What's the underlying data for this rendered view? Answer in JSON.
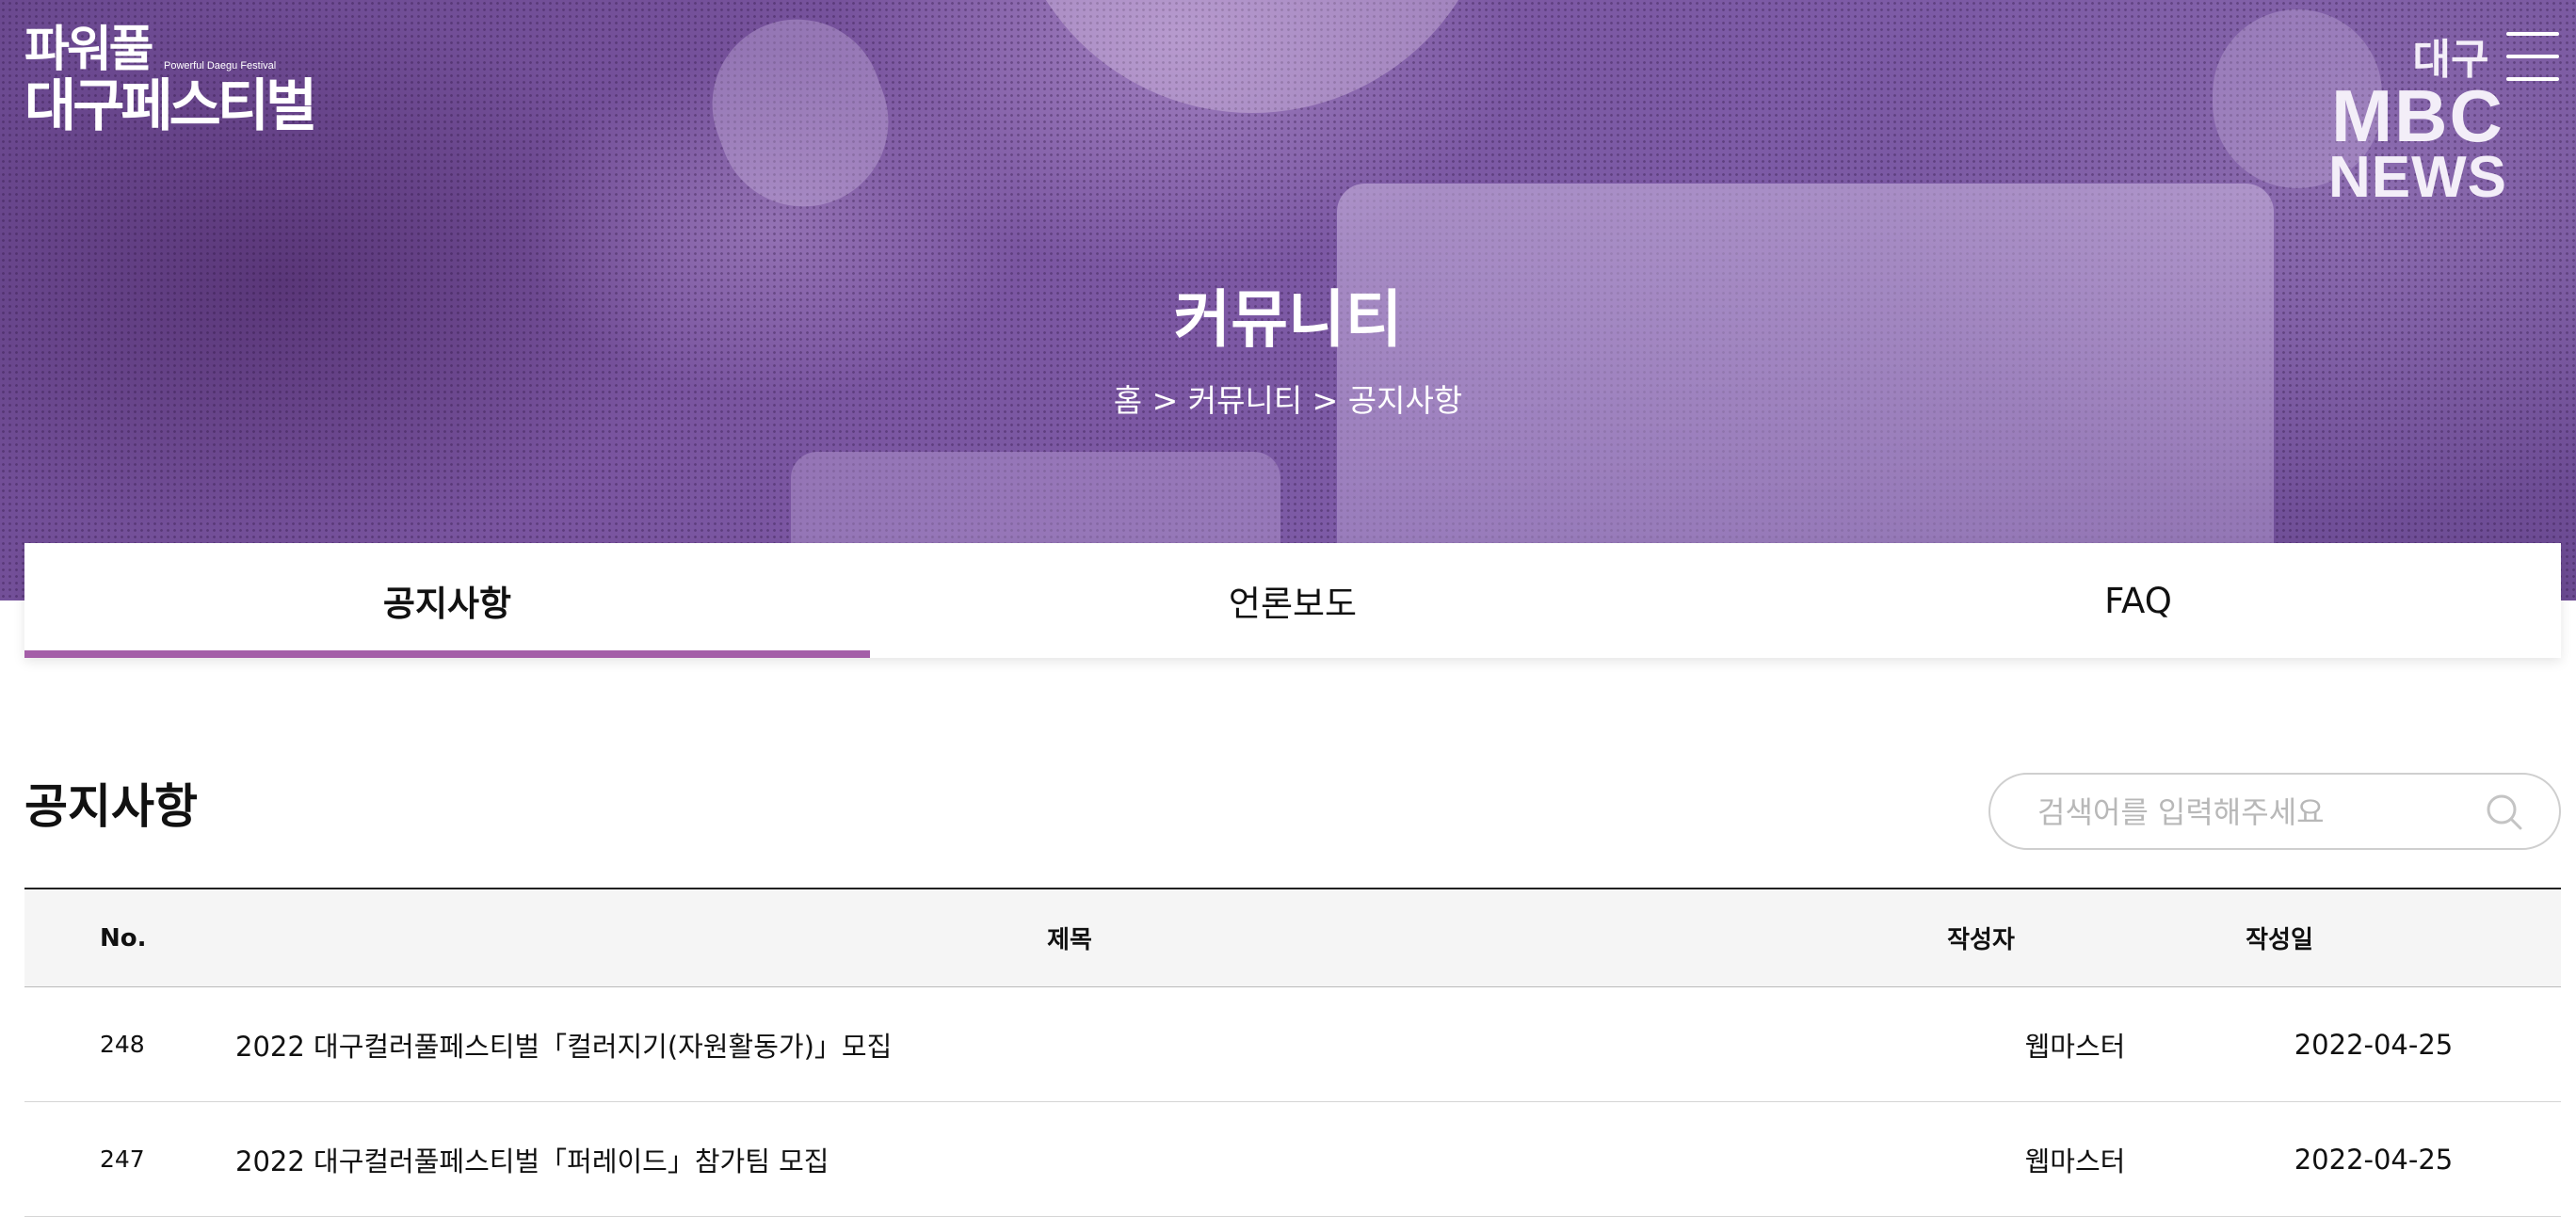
{
  "logo": {
    "line1": "파워풀",
    "line2": "대구페스티벌",
    "subtitle": "Powerful Daegu Festival"
  },
  "broadcaster": {
    "region": "대구",
    "name": "MBC",
    "news": "NEWS"
  },
  "hero": {
    "title": "커뮤니티",
    "breadcrumb": "홈 > 커뮤니티 > 공지사항"
  },
  "tabs": [
    {
      "label": "공지사항",
      "active": true
    },
    {
      "label": "언론보도",
      "active": false
    },
    {
      "label": "FAQ",
      "active": false
    }
  ],
  "board": {
    "title": "공지사항",
    "search_placeholder": "검색어를 입력해주세요",
    "columns": {
      "no": "No.",
      "title": "제목",
      "writer": "작성자",
      "date": "작성일"
    },
    "rows": [
      {
        "no": "248",
        "title": "2022 대구컬러풀페스티벌「컬러지기(자원활동가)」모집",
        "writer": "웹마스터",
        "date": "2022-04-25"
      },
      {
        "no": "247",
        "title": "2022 대구컬러풀페스티벌「퍼레이드」참가팀 모집",
        "writer": "웹마스터",
        "date": "2022-04-25"
      }
    ]
  },
  "colors": {
    "accent": "#a45ea8",
    "hero_tint": "#7a55a0"
  },
  "icons": [
    "menu-icon",
    "search-icon"
  ]
}
